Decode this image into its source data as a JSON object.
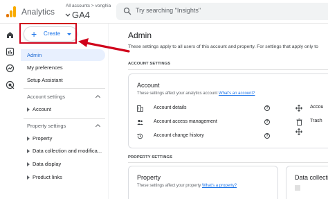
{
  "app": {
    "title": "Analytics",
    "account_small": "All accounts > vonghia",
    "property": "GA4"
  },
  "search": {
    "placeholder": "Try searching \"Insights\""
  },
  "colors": {
    "accent": "#1a73e8",
    "annotation": "#d0021b",
    "active_bg": "#e8f0fe"
  },
  "rail": {
    "icons": [
      "home-icon",
      "reports-icon",
      "explore-icon",
      "advertising-icon"
    ]
  },
  "nav": {
    "create_label": "Create",
    "items": [
      {
        "label": "Admin",
        "active": true
      },
      {
        "label": "My preferences"
      },
      {
        "label": "Setup Assistant"
      }
    ],
    "account_settings": {
      "title": "Account settings",
      "items": [
        "Account"
      ]
    },
    "property_settings": {
      "title": "Property settings",
      "items": [
        "Property",
        "Data collection and modifica...",
        "Data display",
        "Product links"
      ]
    }
  },
  "main": {
    "title": "Admin",
    "description": "These settings apply to all users of this account and property. For settings that apply only to",
    "account_section": "ACCOUNT SETTINGS",
    "account_card": {
      "title": "Account",
      "desc": "These settings affect your analytics account",
      "link": "What's an account?",
      "rows": [
        "Account details",
        "Account access management",
        "Account change history"
      ],
      "right_rows": [
        "Accou",
        "Trash"
      ]
    },
    "property_section": "PROPERTY SETTINGS",
    "property_card": {
      "title": "Property",
      "desc": "These settings affect your property",
      "link": "What's a property?"
    },
    "data_card": {
      "title": "Data collecti"
    }
  }
}
